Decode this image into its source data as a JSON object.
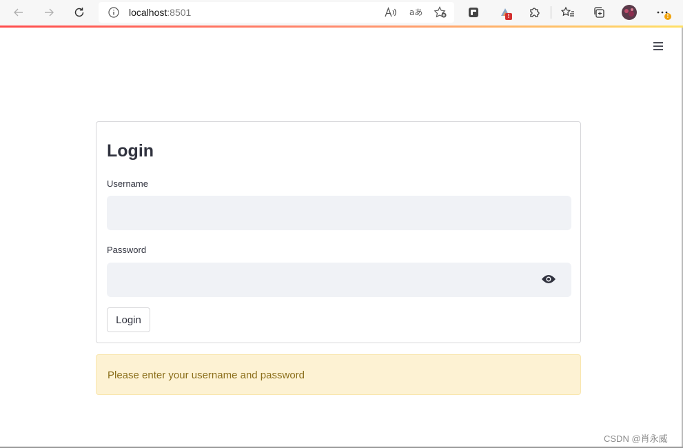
{
  "browser": {
    "url_host": "localhost",
    "url_port": ":8501",
    "extension_badges": [
      "!",
      "!"
    ]
  },
  "form": {
    "title": "Login",
    "username_label": "Username",
    "username_value": "",
    "password_label": "Password",
    "password_value": "",
    "submit_label": "Login"
  },
  "alert": {
    "message": "Please enter your username and password",
    "type": "warning"
  },
  "watermark": "CSDN @肖永威",
  "colors": {
    "accent_gradient": [
      "#ff4b4b",
      "#ffe066"
    ],
    "input_bg": "#f0f2f6",
    "warning_bg": "#fdf2d3",
    "warning_text": "#8b6e1a"
  }
}
